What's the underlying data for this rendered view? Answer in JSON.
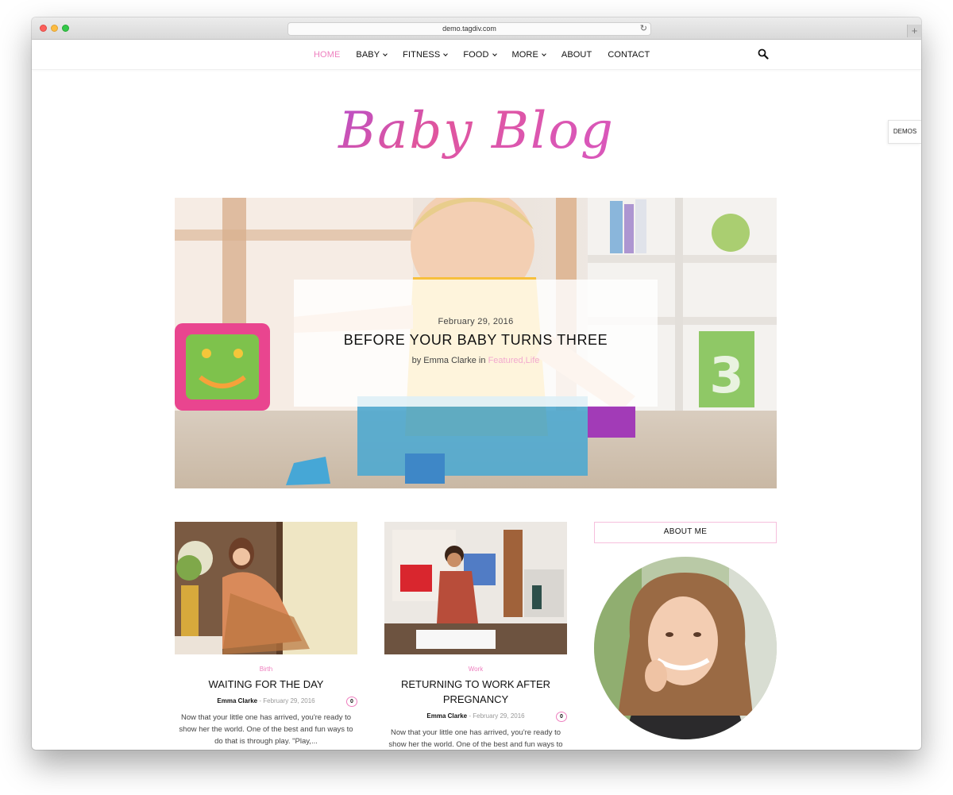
{
  "browser": {
    "url": "demo.tagdiv.com"
  },
  "nav": {
    "items": [
      {
        "label": "HOME",
        "active": true,
        "dropdown": false
      },
      {
        "label": "BABY",
        "active": false,
        "dropdown": true
      },
      {
        "label": "FITNESS",
        "active": false,
        "dropdown": true
      },
      {
        "label": "FOOD",
        "active": false,
        "dropdown": true
      },
      {
        "label": "MORE",
        "active": false,
        "dropdown": true
      },
      {
        "label": "ABOUT",
        "active": false,
        "dropdown": false
      },
      {
        "label": "CONTACT",
        "active": false,
        "dropdown": false
      }
    ],
    "search_icon": "search-icon"
  },
  "logo": {
    "text": "Baby Blog"
  },
  "demos_button": "DEMOS",
  "hero": {
    "date": "February 29, 2016",
    "title": "BEFORE YOUR BABY TURNS THREE",
    "by_prefix": "by Emma Clarke in",
    "categories": [
      "Featured",
      "Life"
    ],
    "category_separator": ","
  },
  "posts": [
    {
      "category": "Birth",
      "title": "WAITING FOR THE DAY",
      "author": "Emma Clarke",
      "separator": "-",
      "date": "February 29, 2016",
      "comments": "0",
      "excerpt": "Now that your little one has arrived, you're ready to show her the world. One of the best and fun ways to do that is through play. \"Play,..."
    },
    {
      "category": "Work",
      "title": "RETURNING TO WORK AFTER PREGNANCY",
      "author": "Emma Clarke",
      "separator": "-",
      "date": "February 29, 2016",
      "comments": "0",
      "excerpt": "Now that your little one has arrived, you're ready to show her the world. One of the best and fun ways to"
    }
  ],
  "sidebar": {
    "about_heading": "ABOUT ME"
  },
  "colors": {
    "accent_pink": "#ee7fbf",
    "logo_gradient": [
      "#c054c8",
      "#e0559d",
      "#f07ab8"
    ]
  }
}
